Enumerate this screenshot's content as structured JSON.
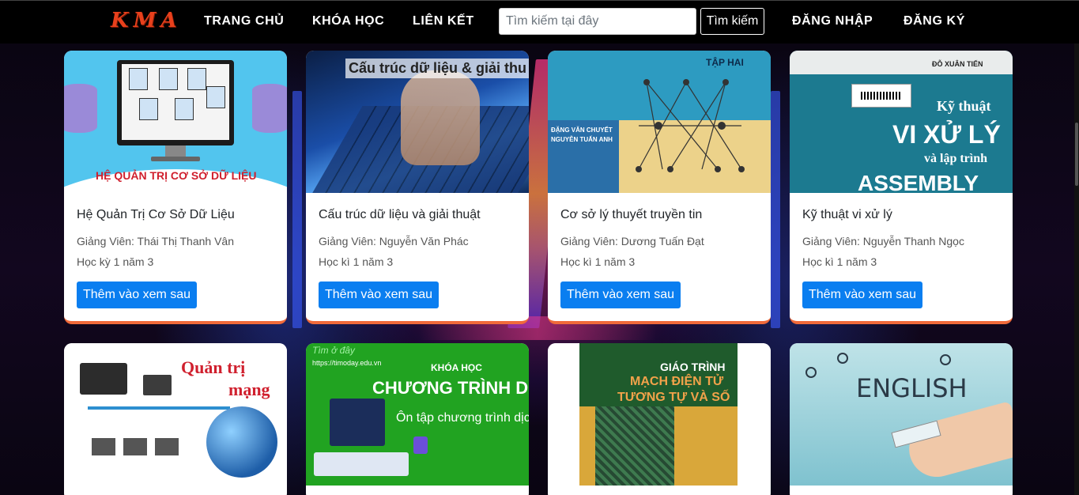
{
  "navbar": {
    "logo": "KMA",
    "links": [
      "TRANG CHỦ",
      "KHÓA HỌC",
      "LIÊN KẾT"
    ],
    "search_placeholder": "Tìm kiếm tại đây",
    "search_button": "Tìm kiếm",
    "login": "ĐĂNG NHẬP",
    "register": "ĐĂNG KÝ"
  },
  "courses": [
    {
      "title": "Hệ Quản Trị Cơ Sở Dữ Liệu",
      "teacher": "Giảng Viên: Thái Thị Thanh Vân",
      "semester": "Học kỳ 1 năm 3",
      "button": "Thêm vào xem sau",
      "thumb_text": "HỆ QUẢN TRỊ CƠ SỞ DỮ LIỆU"
    },
    {
      "title": "Cấu trúc dữ liệu và giải thuật",
      "teacher": "Giảng Viên: Nguyễn Văn Phác",
      "semester": "Học kì 1 năm 3",
      "button": "Thêm vào xem sau",
      "thumb_text": "Cấu trúc dữ liệu & giải thu"
    },
    {
      "title": "Cơ sở lý thuyết truyền tin",
      "teacher": "Giảng Viên: Dương Tuấn Đạt",
      "semester": "Học kì 1 năm 3",
      "button": "Thêm vào xem sau",
      "thumb_text": "TẬP HAI",
      "thumb_authors": [
        "ĐẶNG VĂN CHUYẾT",
        "NGUYỄN TUẤN ANH"
      ]
    },
    {
      "title": "Kỹ thuật vi xử lý",
      "teacher": "Giảng Viên: Nguyễn Thanh Ngọc",
      "semester": "Học kì 1 năm 3",
      "button": "Thêm vào xem sau",
      "thumb_author": "ĐỖ XUÂN TIẾN",
      "thumb_lines": [
        "Kỹ thuật",
        "VI XỬ LÝ",
        "và lập trình",
        "ASSEMBLY"
      ]
    }
  ],
  "courses_row2": [
    {
      "thumb_lines": [
        "Quản trị",
        "mạng"
      ]
    },
    {
      "thumb_lines": [
        "Tìm ở đây",
        "https://timoday.edu.vn",
        "KHÓA HỌC",
        "CHƯƠNG TRÌNH DỊC",
        "Ôn tập chương trình dịch"
      ]
    },
    {
      "thumb_lines": [
        "GIÁO TRÌNH",
        "MẠCH ĐIỆN TỬ",
        "TƯƠNG TỰ VÀ SỐ"
      ]
    },
    {
      "thumb_lines": [
        "ENGLISH"
      ]
    }
  ],
  "colors": {
    "accent": "#0a7ef0",
    "card_border": "#f06a3a",
    "logo": "#e8401c"
  }
}
